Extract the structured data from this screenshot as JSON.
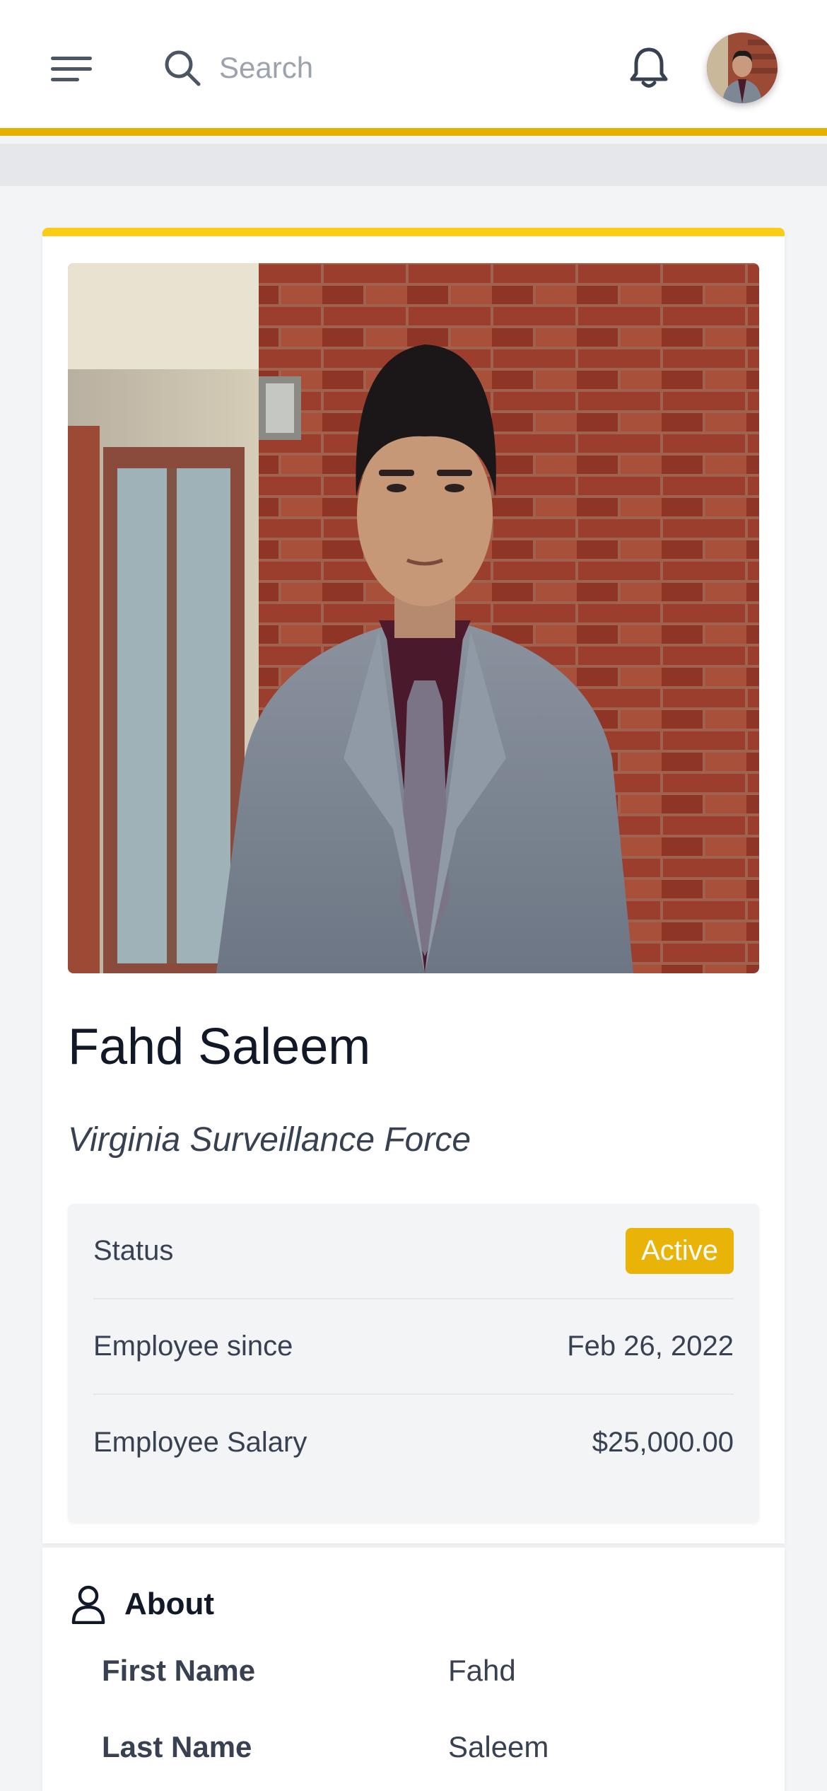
{
  "header": {
    "search": {
      "placeholder": "Search",
      "value": ""
    },
    "icons": {
      "menu": "menu-icon",
      "search": "search-icon",
      "notifications": "bell-icon"
    }
  },
  "profile": {
    "name": "Fahd Saleem",
    "company": "Virginia Surveillance Force",
    "details": [
      {
        "label": "Status",
        "value": "Active",
        "type": "badge"
      },
      {
        "label": "Employee since",
        "value": "Feb 26, 2022"
      },
      {
        "label": "Employee Salary",
        "value": "$25,000.00"
      }
    ]
  },
  "about": {
    "title": "About",
    "icon": "user-icon",
    "rows": [
      {
        "label": "First Name",
        "value": "Fahd"
      },
      {
        "label": "Last Name",
        "value": "Saleem"
      }
    ]
  },
  "colors": {
    "accent": "#e6b000",
    "card_top": "#facc15",
    "badge": "#eab308",
    "text": "#111827",
    "muted": "#374151"
  }
}
